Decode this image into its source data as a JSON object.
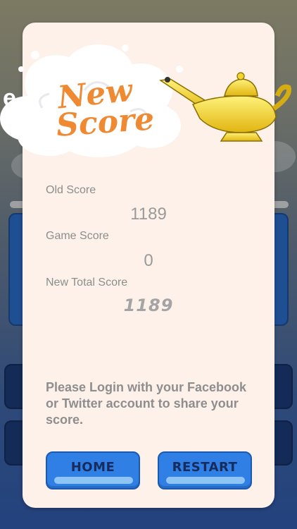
{
  "dialog": {
    "title_line1": "New",
    "title_line2": "Score",
    "old_score_label": "Old Score",
    "old_score_value": "1189",
    "game_score_label": "Game Score",
    "game_score_value": "0",
    "new_total_label": "New Total Score",
    "new_total_value": "1189",
    "login_message": "Please Login with your Facebook or Twitter account to share your score.",
    "buttons": {
      "home": "HOME",
      "restart": "RESTART"
    }
  },
  "colors": {
    "title": "#ef8a33",
    "button_fill": "#2f7fe5",
    "button_text": "#172c5c",
    "dialog_bg": "#fdf1ea"
  },
  "icons": [
    "cloud-icon",
    "genie-lamp-icon"
  ]
}
